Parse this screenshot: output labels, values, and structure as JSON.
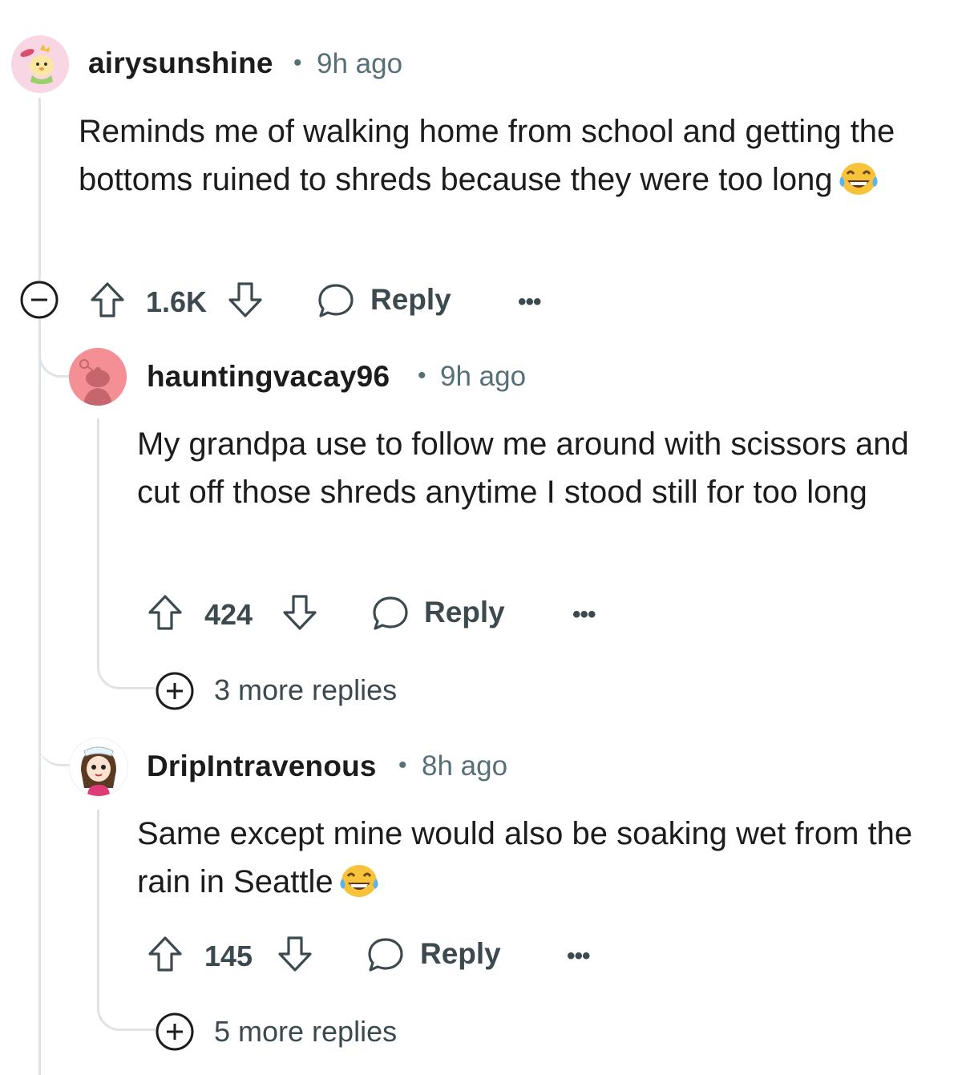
{
  "comments": [
    {
      "author": "airysunshine",
      "separator": "•",
      "time": "9h ago",
      "body": "Reminds me of walking home from school and getting the bottoms ruined to shreds because they were too long",
      "emoji": "laughing-tears",
      "score": "1.6K",
      "reply_label": "Reply",
      "more_label": "•••"
    },
    {
      "author": "hauntingvacay96",
      "separator": "•",
      "time": "9h ago",
      "body": "My grandpa use to follow me around with scissors and cut off those shreds anytime I stood still for too long",
      "score": "424",
      "reply_label": "Reply",
      "more_label": "•••",
      "more_replies": "3 more replies"
    },
    {
      "author": "DripIntravenous",
      "separator": "•",
      "time": "8h ago",
      "body": "Same except mine would also be soaking wet from the rain in Seattle",
      "emoji": "laughing-tears",
      "score": "145",
      "reply_label": "Reply",
      "more_label": "•••",
      "more_replies": "5 more replies"
    }
  ],
  "colors": {
    "meta": "#576f76",
    "thread": "#dfe3e6",
    "action": "#3c4a50"
  }
}
